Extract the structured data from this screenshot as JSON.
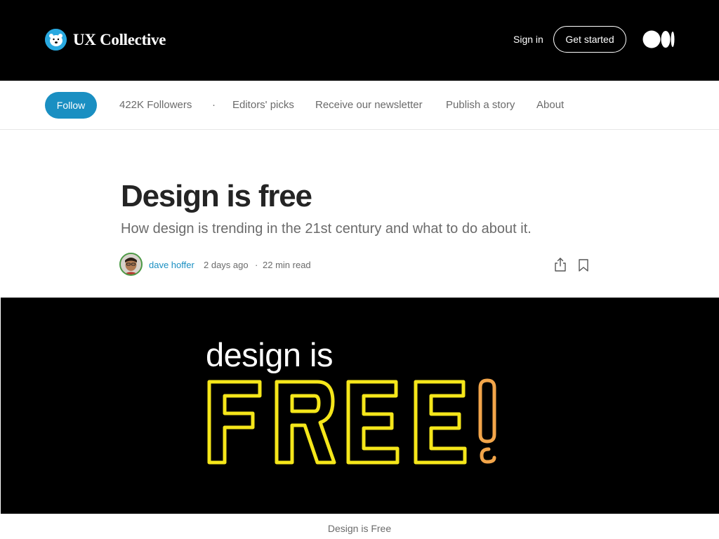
{
  "header": {
    "brand": "UX Collective",
    "sign_in": "Sign in",
    "get_started": "Get started"
  },
  "publication": {
    "follow": "Follow",
    "nav": [
      {
        "label": "422K Followers"
      },
      {
        "label": "·"
      },
      {
        "label": "Editors' picks"
      },
      {
        "label": "Receive our newsletter"
      },
      {
        "label": "Publish a story"
      },
      {
        "label": "About"
      }
    ]
  },
  "article": {
    "title": "Design is free",
    "subtitle": "How design is trending in the 21st century and what to do about it.",
    "author": "dave hoffer",
    "date": "2 days ago",
    "separator": "·",
    "read_time": "22 min read",
    "hero": {
      "line1": "design is",
      "line2": "FREE",
      "exclaim": "!"
    },
    "caption": "Design is Free"
  },
  "icons": {
    "brand_logo": "polar-bear-logo-icon",
    "medium_logo": "medium-logo-icon",
    "share": "share-icon",
    "bookmark": "bookmark-icon"
  },
  "colors": {
    "topbar_bg": "#000000",
    "accent_blue": "#1a8fc2",
    "hero_yellow": "#f5e61a",
    "hero_orange": "#f2a54a"
  }
}
